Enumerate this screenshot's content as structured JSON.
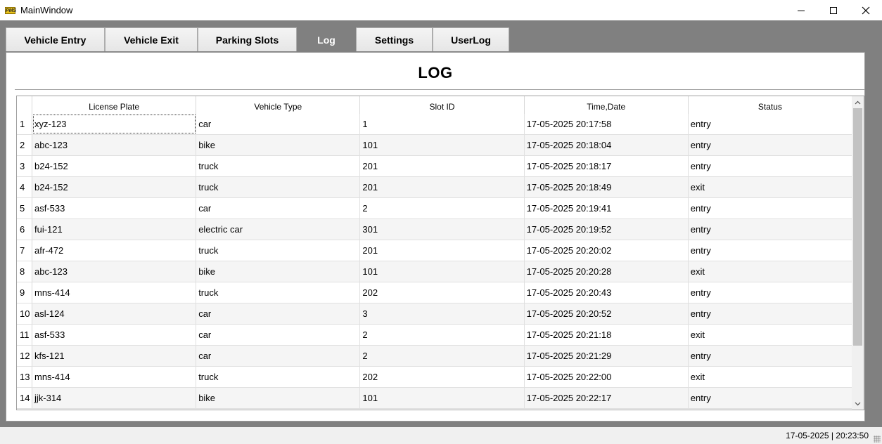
{
  "window": {
    "title": "MainWindow",
    "app_icon_text": "PMS"
  },
  "tabs": [
    {
      "label": "Vehicle Entry"
    },
    {
      "label": "Vehicle Exit"
    },
    {
      "label": "Parking Slots"
    },
    {
      "label": "Log",
      "active": true
    },
    {
      "label": "Settings"
    },
    {
      "label": "UserLog"
    }
  ],
  "page": {
    "heading": "LOG"
  },
  "table": {
    "columns": [
      "License Plate",
      "Vehicle Type",
      "Slot ID",
      "Time,Date",
      "Status"
    ],
    "rows": [
      {
        "n": "1",
        "cells": [
          "xyz-123",
          "car",
          "1",
          "17-05-2025 20:17:58",
          "entry"
        ]
      },
      {
        "n": "2",
        "cells": [
          "abc-123",
          "bike",
          "101",
          "17-05-2025 20:18:04",
          "entry"
        ]
      },
      {
        "n": "3",
        "cells": [
          "b24-152",
          "truck",
          "201",
          "17-05-2025 20:18:17",
          "entry"
        ]
      },
      {
        "n": "4",
        "cells": [
          "b24-152",
          "truck",
          "201",
          "17-05-2025 20:18:49",
          "exit"
        ]
      },
      {
        "n": "5",
        "cells": [
          "asf-533",
          "car",
          "2",
          "17-05-2025 20:19:41",
          "entry"
        ]
      },
      {
        "n": "6",
        "cells": [
          "fui-121",
          "electric car",
          "301",
          "17-05-2025 20:19:52",
          "entry"
        ]
      },
      {
        "n": "7",
        "cells": [
          "afr-472",
          "truck",
          "201",
          "17-05-2025 20:20:02",
          "entry"
        ]
      },
      {
        "n": "8",
        "cells": [
          "abc-123",
          "bike",
          "101",
          "17-05-2025 20:20:28",
          "exit"
        ]
      },
      {
        "n": "9",
        "cells": [
          "mns-414",
          "truck",
          "202",
          "17-05-2025 20:20:43",
          "entry"
        ]
      },
      {
        "n": "10",
        "cells": [
          "asl-124",
          "car",
          "3",
          "17-05-2025 20:20:52",
          "entry"
        ]
      },
      {
        "n": "11",
        "cells": [
          "asf-533",
          "car",
          "2",
          "17-05-2025 20:21:18",
          "exit"
        ]
      },
      {
        "n": "12",
        "cells": [
          "kfs-121",
          "car",
          "2",
          "17-05-2025 20:21:29",
          "entry"
        ]
      },
      {
        "n": "13",
        "cells": [
          "mns-414",
          "truck",
          "202",
          "17-05-2025 20:22:00",
          "exit"
        ]
      },
      {
        "n": "14",
        "cells": [
          "jjk-314",
          "bike",
          "101",
          "17-05-2025 20:22:17",
          "entry"
        ]
      }
    ]
  },
  "statusbar": {
    "text": "17-05-2025  |  20:23:50"
  },
  "colors": {
    "client_bg": "#808080",
    "active_tab": "#808080",
    "alt_row": "#f5f5f5"
  }
}
